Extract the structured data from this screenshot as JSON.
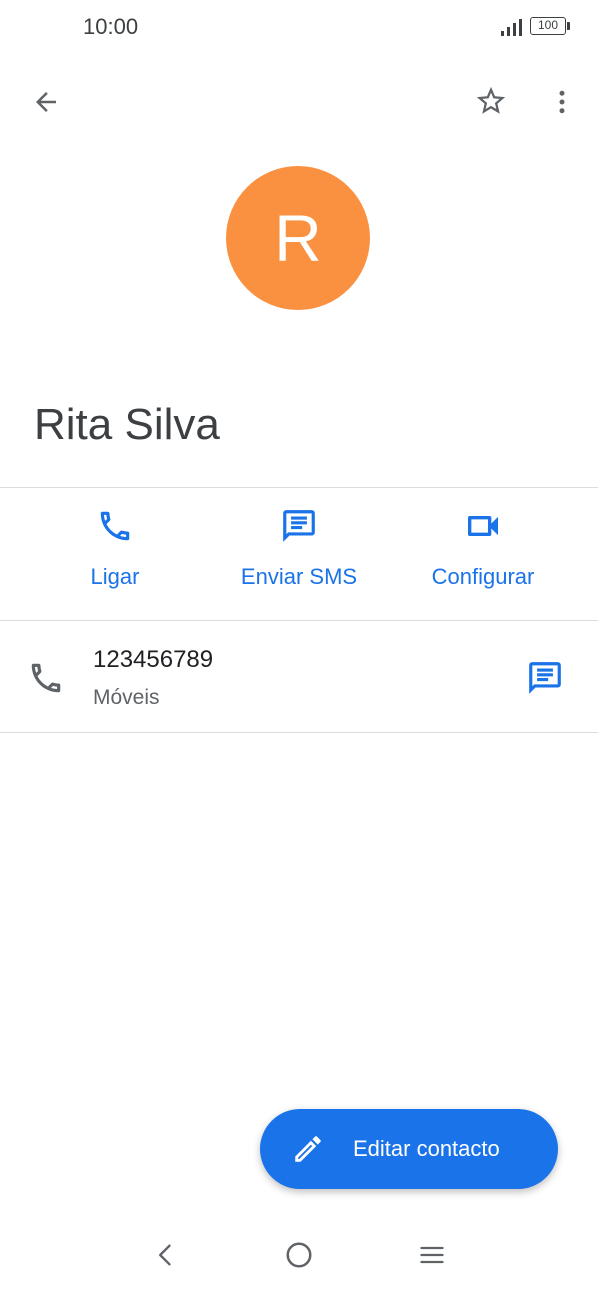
{
  "status_bar": {
    "time": "10:00",
    "battery": "100"
  },
  "top_bar": {
    "back_icon": "arrow-back-icon",
    "star_icon": "star-outline-icon",
    "more_icon": "more-vert-icon"
  },
  "contact": {
    "avatar_letter": "R",
    "avatar_color": "#FA9141",
    "name": "Rita Silva"
  },
  "actions": [
    {
      "label": "Ligar",
      "icon": "phone-icon"
    },
    {
      "label": "Enviar SMS",
      "icon": "message-icon"
    },
    {
      "label": "Configurar",
      "icon": "videocam-icon"
    }
  ],
  "phone_entry": {
    "number": "123456789",
    "type": "Móveis"
  },
  "fab": {
    "label": "Editar contacto",
    "icon": "edit-pencil-icon"
  },
  "nav_bar": {
    "back_icon": "nav-back-icon",
    "home_icon": "nav-home-icon",
    "recents_icon": "nav-menu-icon"
  },
  "colors": {
    "accent": "#1A73E8",
    "divider": "#DADCE0"
  }
}
